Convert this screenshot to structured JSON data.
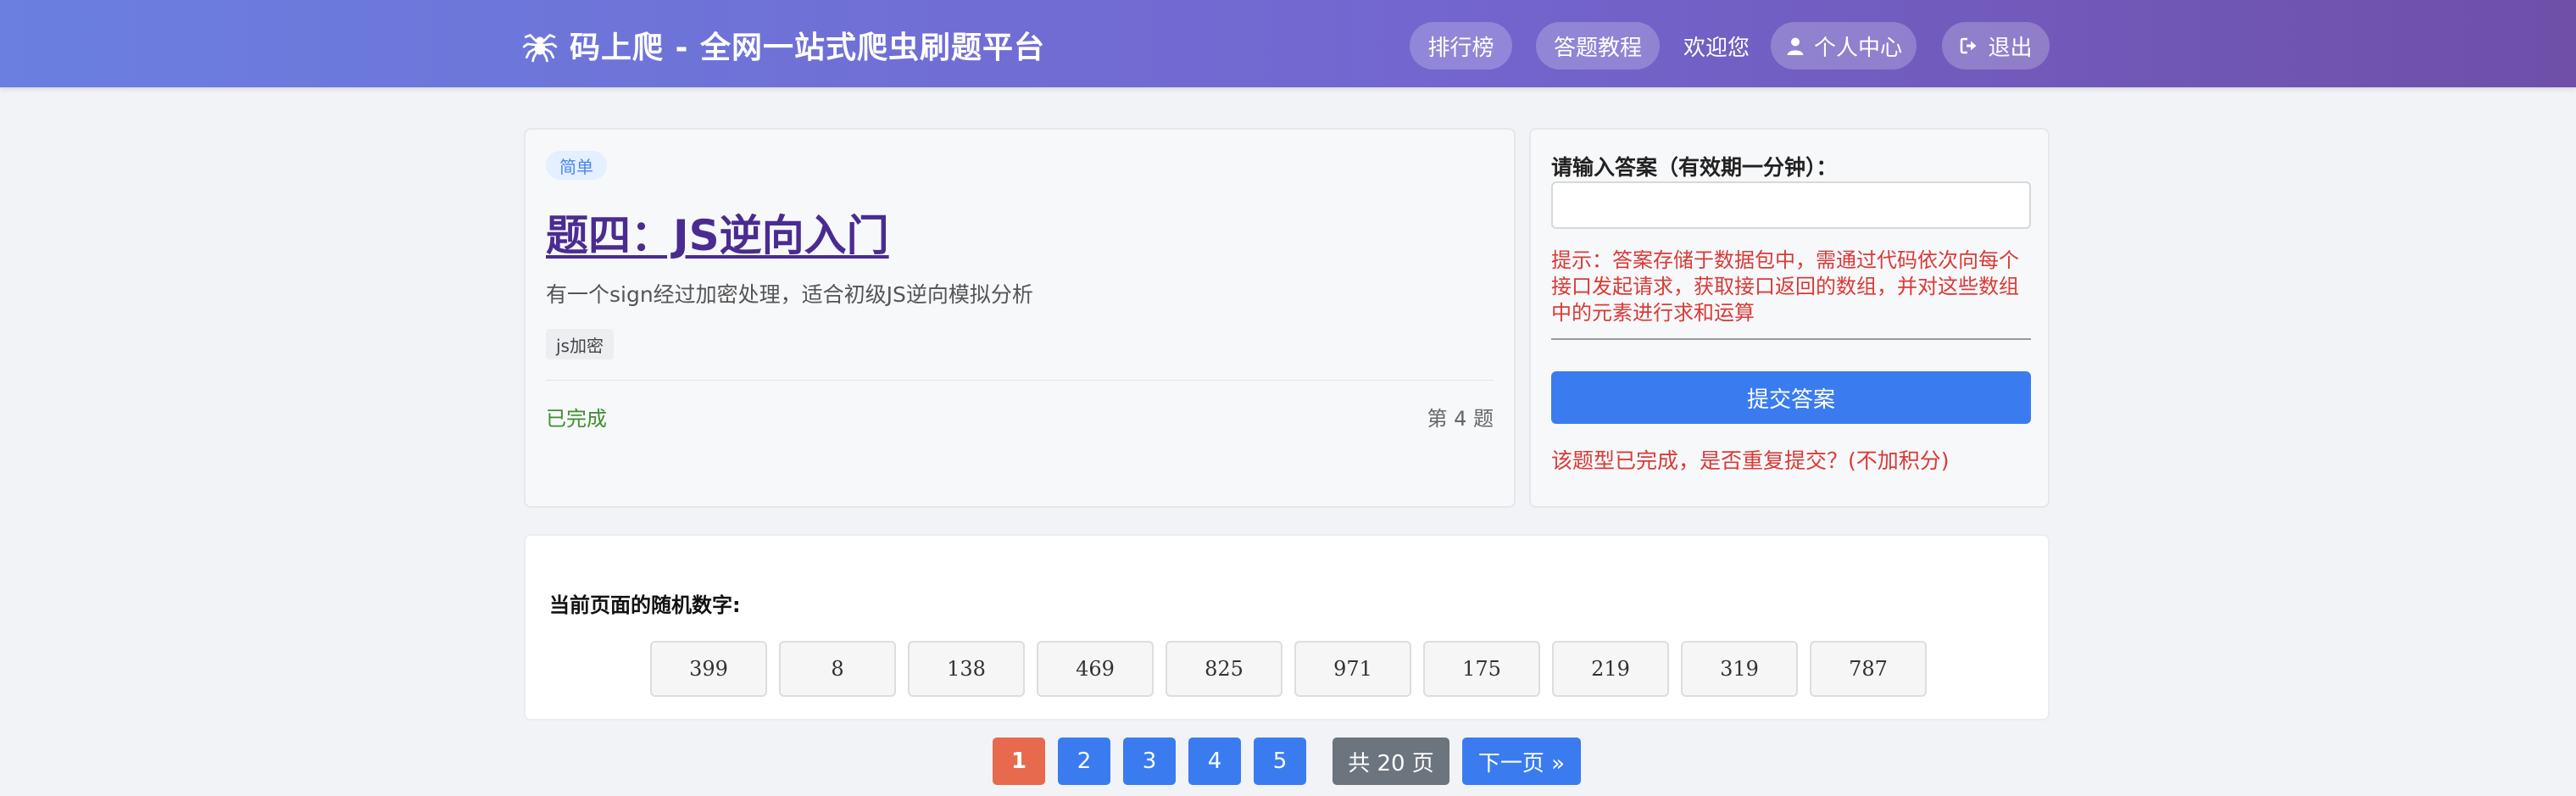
{
  "header": {
    "brand": "码上爬 - 全网一站式爬虫刷题平台",
    "nav": {
      "rank": "排行榜",
      "tutorial": "答题教程",
      "welcome": "欢迎您",
      "profile": "个人中心",
      "logout": "退出"
    }
  },
  "problem": {
    "level": "简单",
    "title": "题四：JS逆向入门",
    "description": "有一个sign经过加密处理，适合初级JS逆向模拟分析",
    "tag": "js加密",
    "status": "已完成",
    "number": "第 4 题"
  },
  "answer": {
    "label": "请输入答案（有效期一分钟）：",
    "input_value": "",
    "hint": "提示：答案存储于数据包中，需通过代码依次向每个接口发起请求，获取接口返回的数组，并对这些数组中的元素进行求和运算",
    "submit": "提交答案",
    "resubmit_msg": "该题型已完成，是否重复提交？(不加积分)"
  },
  "random": {
    "label": "当前页面的随机数字:",
    "numbers": [
      "399",
      "8",
      "138",
      "469",
      "825",
      "971",
      "175",
      "219",
      "319",
      "787"
    ]
  },
  "pagination": {
    "pages": [
      "1",
      "2",
      "3",
      "4",
      "5"
    ],
    "current": "1",
    "total": "共 20 页",
    "next": "下一页 »"
  },
  "colors": {
    "header_start": "#6a7fe0",
    "header_end": "#6f4fa8",
    "primary": "#3a7cf0",
    "active_page": "#e76a4f",
    "success": "#3f8f2e",
    "danger": "#d93a36",
    "title": "#4a2c91"
  },
  "icons": {
    "brand": "spider-icon",
    "profile": "user-icon",
    "logout": "logout-icon"
  }
}
